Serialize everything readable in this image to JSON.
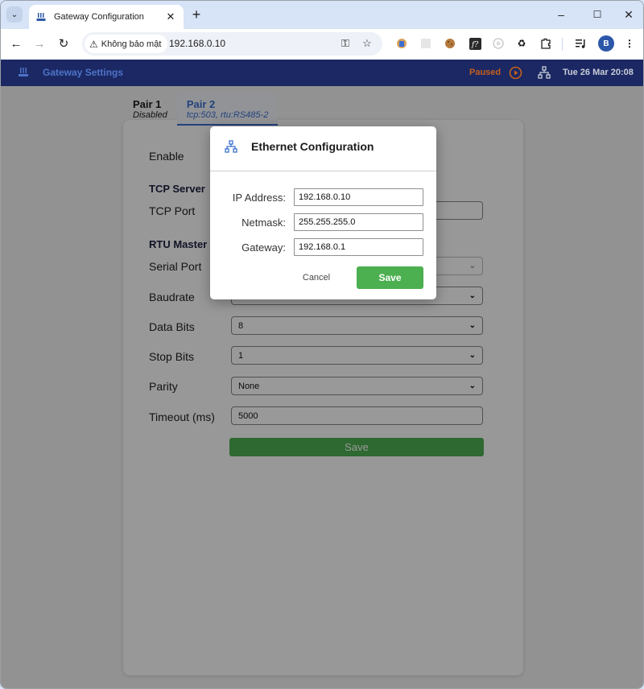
{
  "browser": {
    "tab_title": "Gateway Configuration",
    "security_label": "Không bảo mật",
    "url": "192.168.0.10",
    "profile_initial": "B",
    "icons": [
      "tab-search-icon",
      "back-icon",
      "forward-icon",
      "reload-icon",
      "warning-icon",
      "password-key-icon",
      "bookmark-star-icon",
      "extensions-icon",
      "media-control-icon",
      "menu-kebab-icon"
    ]
  },
  "app": {
    "title": "Gateway Settings",
    "status": "Paused",
    "datetime": "Tue 26 Mar 20:08",
    "colors": {
      "appbar": "#1b2863",
      "title": "#4e73c9",
      "status": "#c45f1d",
      "accent": "#3b6fd0",
      "save": "#4caf50"
    }
  },
  "tabs": [
    {
      "name": "Pair 1",
      "sub": "Disabled",
      "active": false
    },
    {
      "name": "Pair 2",
      "sub": "tcp:503, rtu:RS485-2",
      "active": true
    }
  ],
  "form": {
    "enable_label": "Enable",
    "tcp_section": "TCP Server",
    "tcp_port_label": "TCP Port",
    "tcp_port_value": "",
    "rtu_section": "RTU Master",
    "serial_port_label": "Serial Port",
    "serial_port_value": "",
    "baudrate_label": "Baudrate",
    "baudrate_value": "",
    "data_bits_label": "Data Bits",
    "data_bits_value": "8",
    "stop_bits_label": "Stop Bits",
    "stop_bits_value": "1",
    "parity_label": "Parity",
    "parity_value": "None",
    "timeout_label": "Timeout (ms)",
    "timeout_value": "5000",
    "save_label": "Save"
  },
  "modal": {
    "title": "Ethernet Configuration",
    "ip_label": "IP Address:",
    "ip_value": "192.168.0.10",
    "netmask_label": "Netmask:",
    "netmask_value": "255.255.255.0",
    "gateway_label": "Gateway:",
    "gateway_value": "192.168.0.1",
    "cancel_label": "Cancel",
    "save_label": "Save"
  }
}
